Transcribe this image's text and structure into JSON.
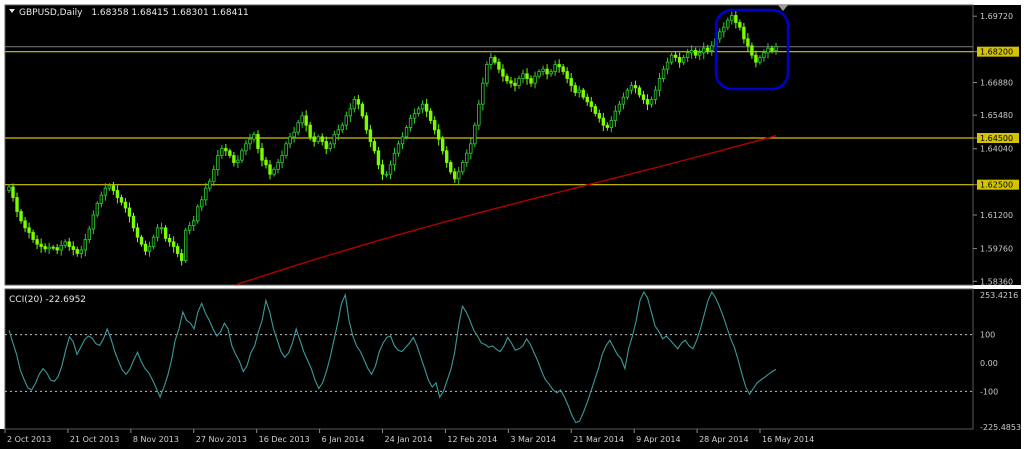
{
  "chart_data": [
    {
      "type": "candlestick",
      "header": {
        "symbol": "GBPUSD,Daily",
        "values": "1.68358 1.68415 1.68301 1.68411"
      },
      "price_scale": [
        "1.69720",
        "1.68200",
        "1.66880",
        "1.65480",
        "1.64500",
        "1.64040",
        "1.62500",
        "1.61200",
        "1.59760",
        "1.58360"
      ],
      "ylim": [
        1.582,
        1.702
      ],
      "horizontal_levels": [
        "1.68200",
        "1.64500",
        "1.62500"
      ],
      "current_price": "1.68411",
      "date_labels": [
        "2 Oct 2013",
        "21 Oct 2013",
        "8 Nov 2013",
        "27 Nov 2013",
        "16 Dec 2013",
        "6 Jan 2014",
        "24 Jan 2014",
        "12 Feb 2014",
        "3 Mar 2014",
        "21 Mar 2014",
        "9 Apr 2014",
        "28 Apr 2014",
        "16 May 2014"
      ],
      "bull_color": "#32cd32",
      "bear_color": "#7cfc00",
      "moving_average_color": "#b00000",
      "level_color": "#d4c400",
      "highlight_color": "#0000cc",
      "close_series": [
        1.624,
        1.6195,
        1.6135,
        1.6095,
        1.6065,
        1.6045,
        1.6015,
        1.5995,
        1.5985,
        1.5975,
        1.5982,
        1.598,
        1.597,
        1.599,
        1.6005,
        1.5985,
        1.5972,
        1.5955,
        1.597,
        1.6015,
        1.606,
        1.612,
        1.617,
        1.6205,
        1.6235,
        1.6245,
        1.6225,
        1.6195,
        1.6175,
        1.615,
        1.6115,
        1.6065,
        1.6025,
        1.5995,
        1.5965,
        1.5985,
        1.6025,
        1.6065,
        1.6065,
        1.602,
        1.6005,
        1.5985,
        1.5955,
        1.5925,
        1.6055,
        1.6075,
        1.6095,
        1.6155,
        1.6185,
        1.6235,
        1.6265,
        1.6315,
        1.6375,
        1.6405,
        1.6395,
        1.6375,
        1.6345,
        1.6355,
        1.6395,
        1.6425,
        1.6445,
        1.6465,
        1.6405,
        1.6355,
        1.6335,
        1.6295,
        1.6315,
        1.6345,
        1.6375,
        1.6425,
        1.6455,
        1.6475,
        1.6515,
        1.6545,
        1.6505,
        1.6455,
        1.6435,
        1.6455,
        1.6435,
        1.6405,
        1.6425,
        1.6465,
        1.6485,
        1.6505,
        1.6545,
        1.6575,
        1.6615,
        1.6595,
        1.6545,
        1.6485,
        1.6435,
        1.6395,
        1.6335,
        1.6295,
        1.6295,
        1.6335,
        1.6385,
        1.6425,
        1.6455,
        1.6495,
        1.6535,
        1.6555,
        1.6575,
        1.6595,
        1.6565,
        1.6525,
        1.6485,
        1.6445,
        1.6395,
        1.6345,
        1.6305,
        1.6275,
        1.6305,
        1.6345,
        1.6385,
        1.6425,
        1.6505,
        1.6595,
        1.6685,
        1.6765,
        1.6795,
        1.6775,
        1.6745,
        1.6715,
        1.6695,
        1.6685,
        1.6675,
        1.6705,
        1.6725,
        1.6705,
        1.6685,
        1.6715,
        1.6735,
        1.6745,
        1.6725,
        1.6735,
        1.6765,
        1.6755,
        1.6735,
        1.6705,
        1.6675,
        1.6645,
        1.6655,
        1.6625,
        1.6605,
        1.6585,
        1.6555,
        1.6535,
        1.6505,
        1.6495,
        1.6525,
        1.6565,
        1.6595,
        1.6625,
        1.6655,
        1.6675,
        1.6665,
        1.6635,
        1.6615,
        1.6595,
        1.6615,
        1.6655,
        1.6705,
        1.6745,
        1.6775,
        1.6805,
        1.6795,
        1.6775,
        1.6795,
        1.6815,
        1.6825,
        1.6805,
        1.6815,
        1.6835,
        1.6825,
        1.6845,
        1.6875,
        1.6905,
        1.6925,
        1.6955,
        1.6975,
        1.6945,
        1.6925,
        1.6875,
        1.6845,
        1.6805,
        1.6775,
        1.6795,
        1.6815,
        1.6835,
        1.6825,
        1.6841
      ]
    },
    {
      "type": "line",
      "header": "CCI(20) -22.6952",
      "indicator_scale": [
        "253.4216",
        "100",
        "0.00",
        "-100",
        "-225.4853"
      ],
      "ylim": [
        -225.4853,
        253.4216
      ],
      "reference_levels": [
        100,
        -100
      ],
      "line_color": "#3a9a9a",
      "values": [
        115,
        72,
        30,
        -25,
        -58,
        -88,
        -95,
        -72,
        -40,
        -20,
        -35,
        -60,
        -65,
        -48,
        -10,
        45,
        92,
        75,
        30,
        55,
        82,
        95,
        88,
        68,
        62,
        85,
        120,
        85,
        40,
        5,
        -25,
        -40,
        -22,
        10,
        38,
        5,
        -20,
        -35,
        -60,
        -90,
        -120,
        -85,
        -45,
        10,
        80,
        120,
        180,
        150,
        140,
        120,
        180,
        210,
        175,
        150,
        120,
        95,
        110,
        140,
        120,
        60,
        30,
        5,
        -30,
        -10,
        35,
        60,
        110,
        150,
        220,
        180,
        120,
        80,
        40,
        20,
        35,
        70,
        120,
        80,
        40,
        10,
        -20,
        -60,
        -90,
        -70,
        -30,
        20,
        80,
        140,
        210,
        240,
        150,
        95,
        60,
        40,
        10,
        -20,
        -40,
        -10,
        40,
        70,
        90,
        95,
        60,
        45,
        40,
        55,
        70,
        90,
        60,
        20,
        -20,
        -60,
        -85,
        -70,
        -120,
        -100,
        -60,
        -20,
        40,
        130,
        200,
        180,
        150,
        115,
        95,
        70,
        65,
        55,
        60,
        48,
        40,
        60,
        90,
        70,
        45,
        50,
        60,
        85,
        65,
        35,
        5,
        -30,
        -60,
        -75,
        -95,
        -105,
        -95,
        -120,
        -150,
        -185,
        -210,
        -205,
        -175,
        -140,
        -100,
        -60,
        -20,
        30,
        60,
        80,
        55,
        30,
        15,
        -20,
        50,
        95,
        150,
        220,
        250,
        230,
        180,
        130,
        110,
        85,
        95,
        80,
        65,
        50,
        70,
        80,
        60,
        50,
        80,
        120,
        170,
        220,
        250,
        230,
        200,
        165,
        125,
        85,
        55,
        10,
        -40,
        -85,
        -110,
        -90,
        -70,
        -60,
        -50,
        -40,
        -30,
        -22.6952
      ]
    }
  ]
}
